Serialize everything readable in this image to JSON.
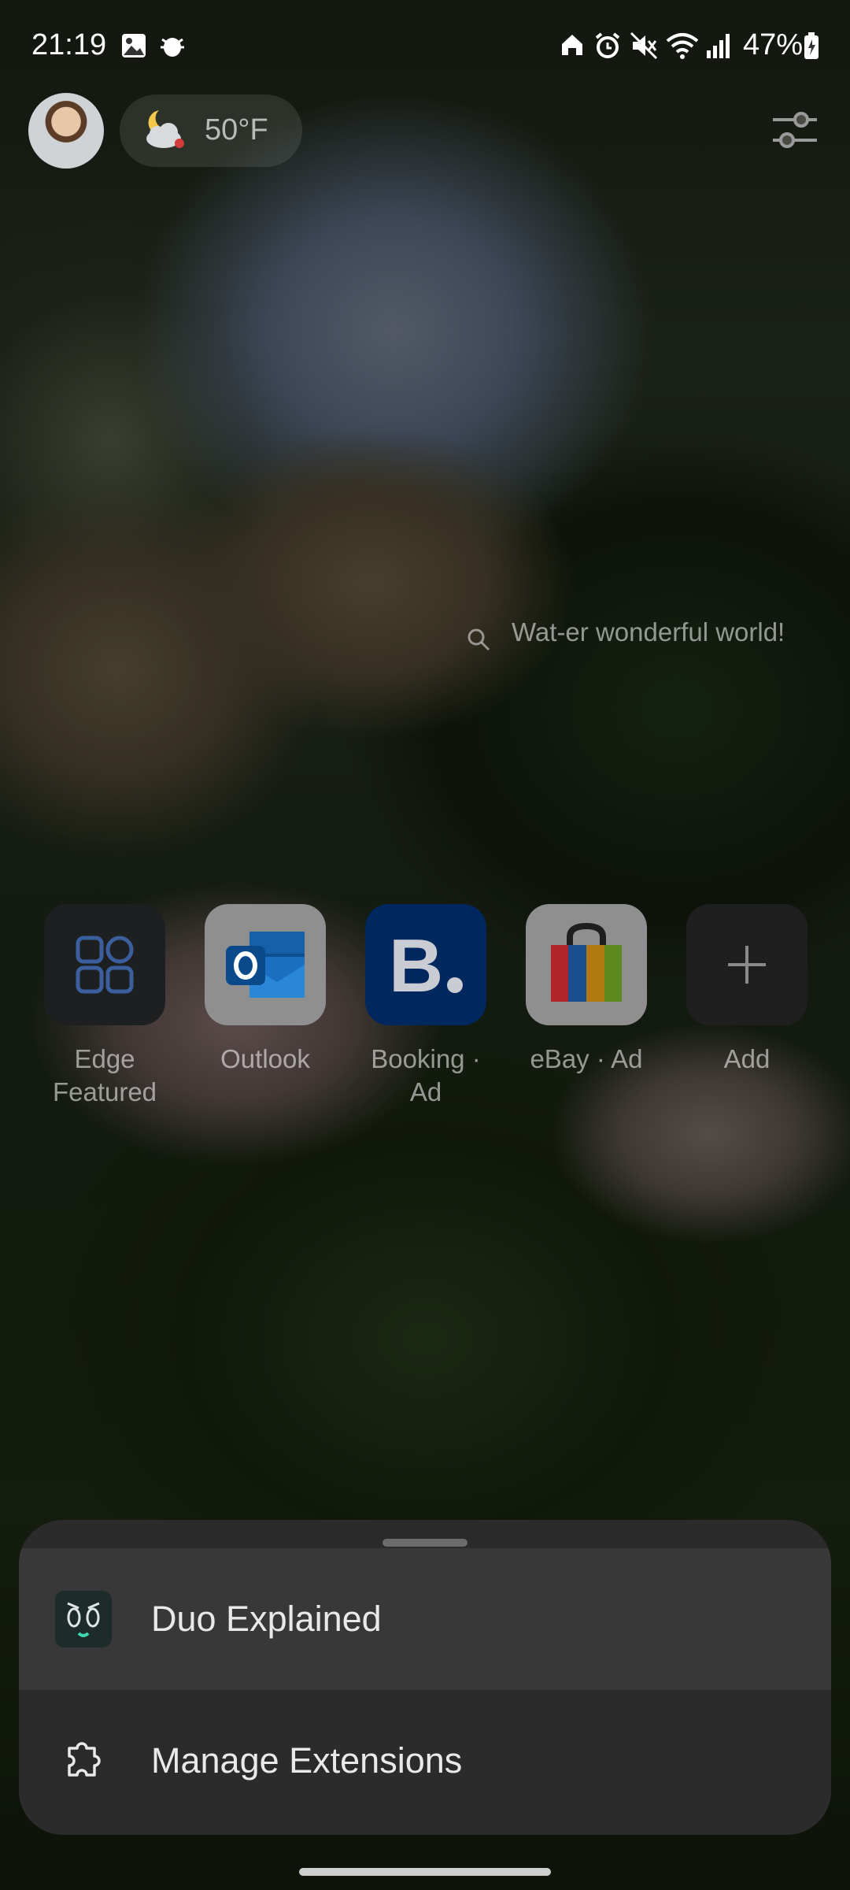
{
  "status_bar": {
    "time": "21:19",
    "battery": "47%",
    "left_icons": [
      "gallery-icon",
      "bug-icon"
    ],
    "right_icons": [
      "home-icon",
      "alarm-icon",
      "mute-icon",
      "wifi-icon",
      "signal-icon",
      "battery-icon"
    ]
  },
  "header": {
    "weather_temp": "50°F",
    "weather_icon": "partly-cloudy-night-icon"
  },
  "search": {
    "hint": "Wat-er wonderful world!"
  },
  "quick_links": [
    {
      "label": "Edge Featured",
      "icon": "edge-featured-icon"
    },
    {
      "label": "Outlook",
      "icon": "outlook-icon"
    },
    {
      "label": "Booking · Ad",
      "icon": "booking-icon"
    },
    {
      "label": "eBay · Ad",
      "icon": "ebay-icon"
    },
    {
      "label": "Add",
      "icon": "plus-icon"
    }
  ],
  "sheet": {
    "items": [
      {
        "label": "Duo Explained",
        "icon": "duo-icon"
      },
      {
        "label": "Manage Extensions",
        "icon": "puzzle-icon"
      }
    ]
  },
  "colors": {
    "sheet_bg": "#2b2b2b",
    "highlight_row": "#383838",
    "booking_blue": "#003580",
    "outlook_blue": "#0f6cbd"
  }
}
